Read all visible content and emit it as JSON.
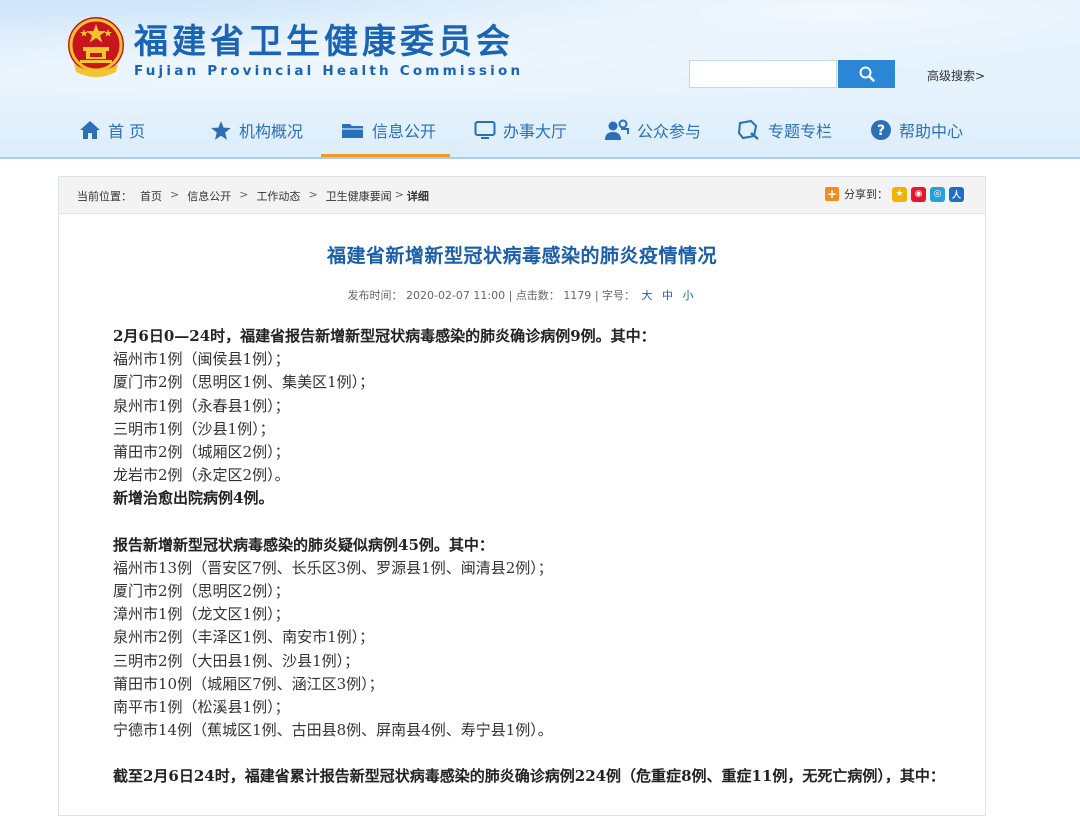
{
  "header": {
    "title": "福建省卫生健康委员会",
    "subtitle": "Fujian Provincial Health Commission",
    "search_placeholder": "",
    "advanced_search": "高级搜索>"
  },
  "nav": [
    {
      "label": "首 页",
      "icon": "home-icon"
    },
    {
      "label": "机构概况",
      "icon": "star-icon"
    },
    {
      "label": "信息公开",
      "icon": "folder-icon"
    },
    {
      "label": "办事大厅",
      "icon": "monitor-icon"
    },
    {
      "label": "公众参与",
      "icon": "people-icon"
    },
    {
      "label": "专题专栏",
      "icon": "topic-icon"
    },
    {
      "label": "帮助中心",
      "icon": "help-icon"
    }
  ],
  "breadcrumb": {
    "prefix": "当前位置：",
    "items": [
      "首页",
      "信息公开",
      "工作动态",
      "卫生健康要闻",
      "详细"
    ]
  },
  "share": {
    "label": "分享到："
  },
  "article": {
    "title": "福建省新增新型冠状病毒感染的肺炎疫情情况",
    "meta_date_label": "发布时间：",
    "meta_date": "2020-02-07 11:00",
    "meta_clicks_label": "点击数：",
    "meta_clicks": "1179",
    "meta_fontsize_label": "字号：",
    "font_sizes": [
      "大",
      "中",
      "小"
    ],
    "lines": [
      "2月6日0—24时，福建省报告新增新型冠状病毒感染的肺炎确诊病例9例。其中：",
      "福州市1例（闽侯县1例）；",
      "厦门市2例（思明区1例、集美区1例）；",
      "泉州市1例（永春县1例）；",
      "三明市1例（沙县1例）；",
      "莆田市2例（城厢区2例）；",
      "龙岩市2例（永定区2例）。",
      "新增治愈出院病例4例。",
      "报告新增新型冠状病毒感染的肺炎疑似病例45例。其中：",
      "福州市13例（晋安区7例、长乐区3例、罗源县1例、闽清县2例）；",
      "厦门市2例（思明区2例）；",
      "漳州市1例（龙文区1例）；",
      "泉州市2例（丰泽区1例、南安市1例）；",
      "三明市2例（大田县1例、沙县1例）；",
      "莆田市10例（城厢区7例、涵江区3例）；",
      "南平市1例（松溪县1例）；",
      "宁德市14例（蕉城区1例、古田县8例、屏南县4例、寿宁县1例）。",
      "截至2月6日24时，福建省累计报告新型冠状病毒感染的肺炎确诊病例224例（危重症8例、重症11例，无死亡病例），其中："
    ]
  },
  "colors": {
    "brand_blue": "#1b64b5",
    "nav_active": "#f39a1e",
    "search_button": "#2c86d6"
  }
}
